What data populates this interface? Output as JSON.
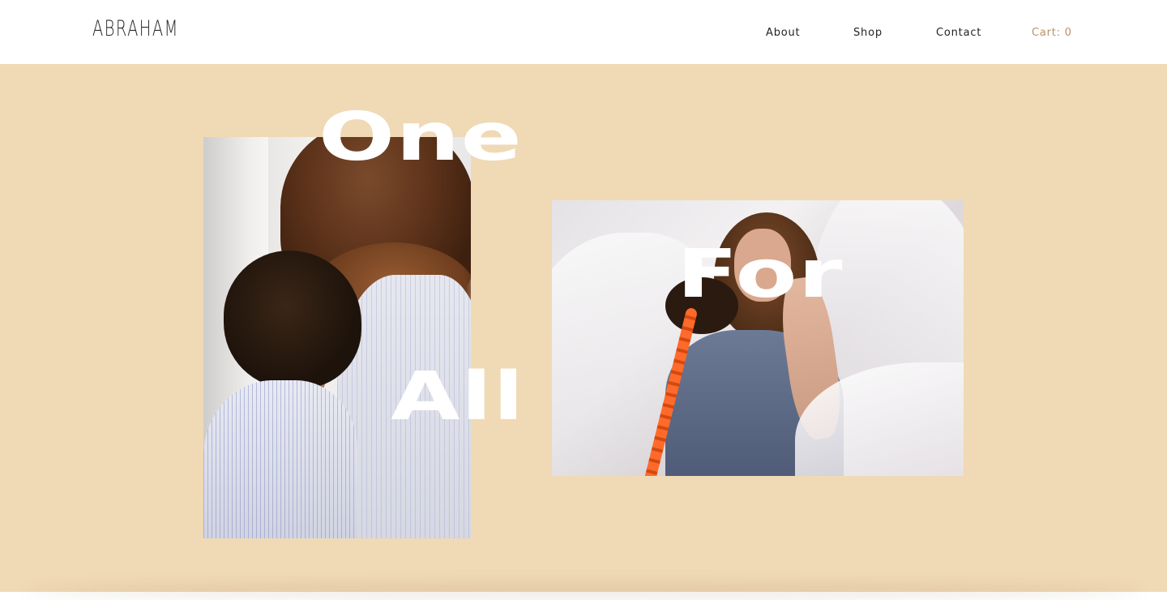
{
  "header": {
    "brand": "ABRAHAM",
    "nav": {
      "about": "About",
      "shop": "Shop",
      "contact": "Contact",
      "cart": "Cart: 0"
    }
  },
  "hero": {
    "background_color": "#f0d9b5",
    "words": {
      "one": "One",
      "for": "For",
      "all": "All"
    }
  },
  "colors": {
    "cart_accent": "#b8926a",
    "nav_text": "#222222",
    "hero_text": "#ffffff"
  }
}
